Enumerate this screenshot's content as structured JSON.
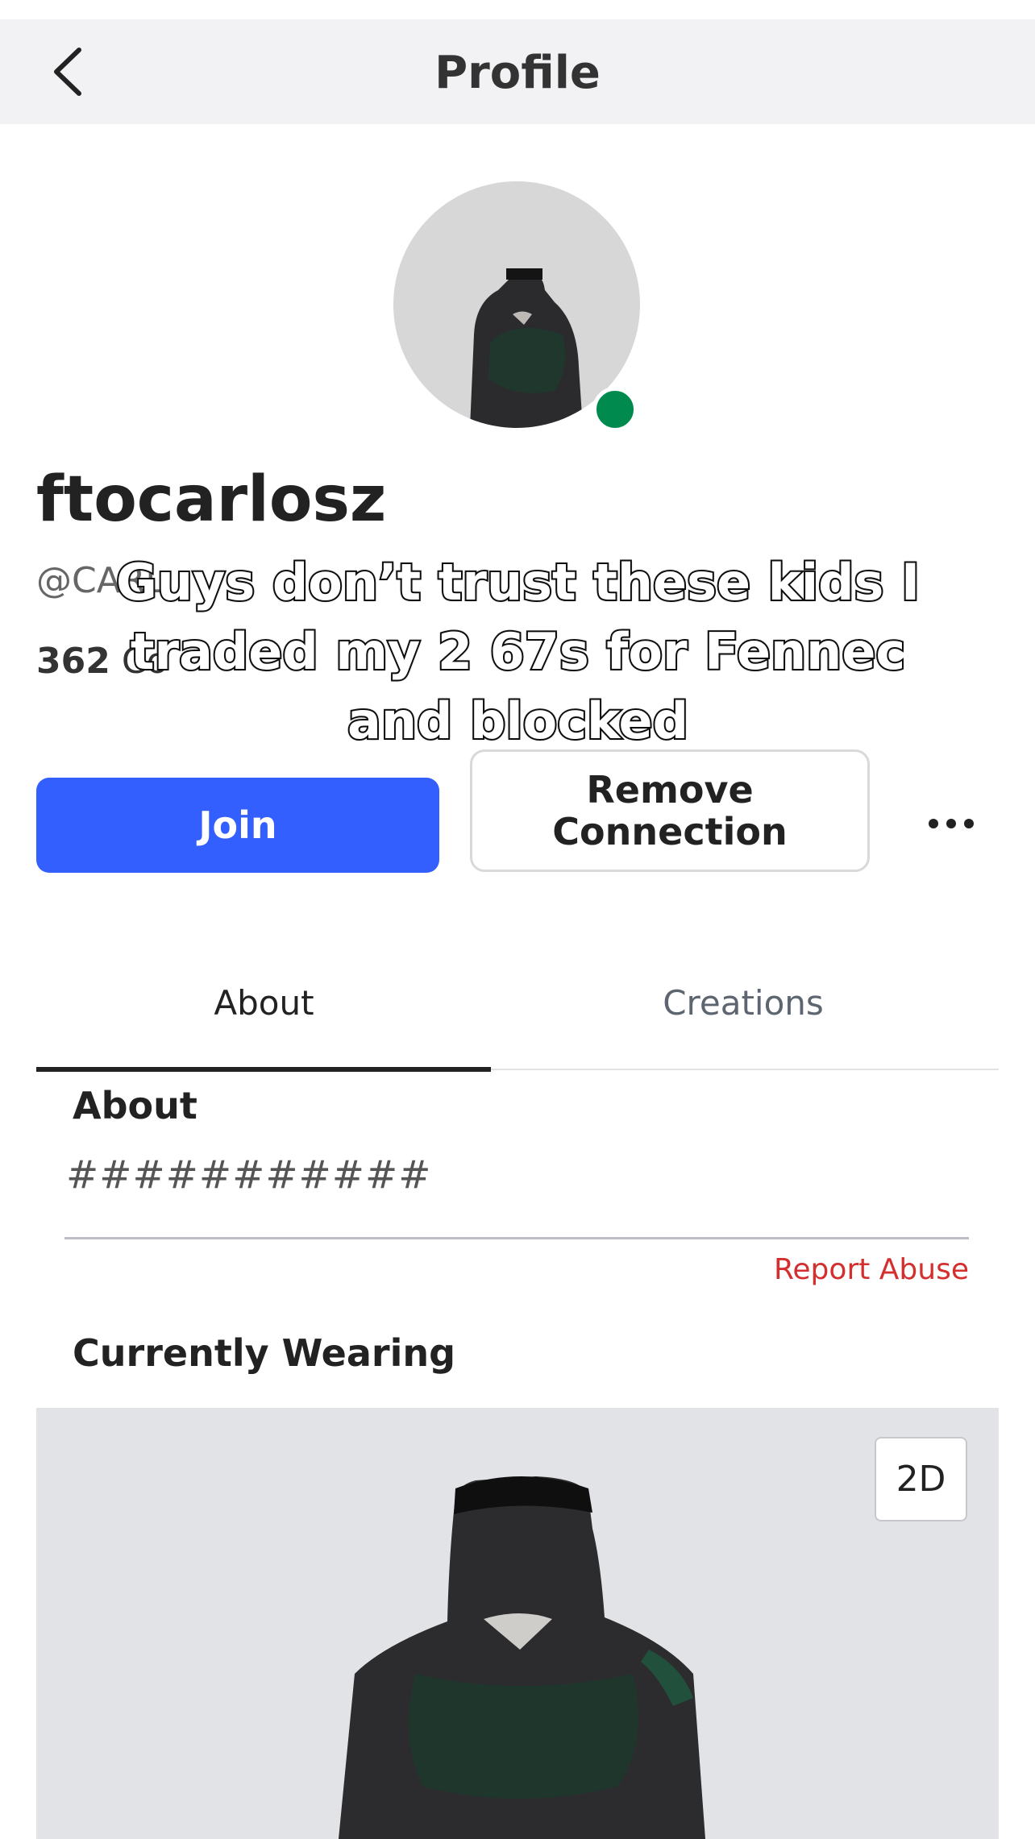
{
  "header": {
    "title": "Profile",
    "back_icon": "chevron-left-icon"
  },
  "profile": {
    "display_name": "ftocarlosz",
    "handle": "@CARL",
    "stats_count": "362",
    "stats_label": "Co",
    "online_status_color": "#008a4e"
  },
  "overlay_caption": "Guys don’t trust these kids I traded my 2 67s for Fennec and blocked",
  "actions": {
    "join_label": "Join",
    "join_color": "#335fff",
    "remove_label": "Remove\nConnection",
    "more_icon": "more-horizontal-icon"
  },
  "tabs": [
    {
      "label": "About",
      "active": true
    },
    {
      "label": "Creations",
      "active": false
    }
  ],
  "about": {
    "heading": "About",
    "text": "###########",
    "report_label": "Report Abuse",
    "report_color": "#d32f2f"
  },
  "wearing": {
    "heading": "Currently Wearing",
    "view_toggle_label": "2D"
  }
}
